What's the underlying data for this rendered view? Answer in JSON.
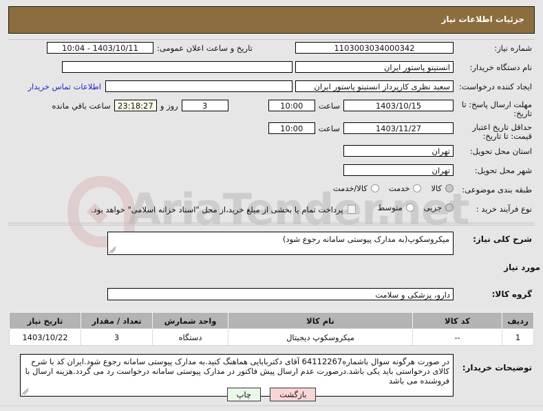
{
  "banner": {
    "title": "جزئیات اطلاعات نیاز"
  },
  "form": {
    "need_number": {
      "label": "شماره نیاز:",
      "value": "1103003034000342"
    },
    "announce_datetime": {
      "label": "تاریخ و ساعت اعلان عمومی:",
      "value": "1403/10/11 - 10:04"
    },
    "buyer_org": {
      "label": "نام دستگاه خریدار:",
      "value": "انستیتو پاستور ایران"
    },
    "buyer_org_secondary": {
      "label": "",
      "value": ""
    },
    "requester": {
      "label": "ایجاد کننده درخواست:",
      "value": "سعید نظری کارپرداز انستیتو پاستور ایران"
    },
    "contact_link": {
      "label": "اطلاعات تماس خریدار",
      "value": ""
    },
    "response_deadline": {
      "label": "مهلت ارسال پاسخ: تا تاریخ:",
      "date": "1403/10/15",
      "time_label": "ساعت",
      "time": "10:00",
      "days": "3",
      "days_label": "روز و",
      "countdown": "23:18:27",
      "countdown_label": "ساعت باقي مانده"
    },
    "price_validity": {
      "label": "حداقل تاریخ اعتبار قیمت: تا تاریخ:",
      "date": "1403/11/27",
      "time_label": "ساعت",
      "time": "10:00"
    },
    "delivery_province": {
      "label": "استان محل تحویل:",
      "value": "تهران"
    },
    "delivery_city": {
      "label": "شهر محل تحویل:",
      "value": "تهران"
    },
    "subject_classification": {
      "label": "طبقه بندی موضوعی:",
      "options": [
        {
          "label": "کالا",
          "selected": true
        },
        {
          "label": "خدمت",
          "selected": false
        },
        {
          "label": "کالا/خدمت",
          "selected": false
        }
      ]
    },
    "purchase_process": {
      "label": "نوع فرآیند خرید :",
      "options": [
        {
          "label": "جزیی",
          "selected": true
        },
        {
          "label": "متوسط",
          "selected": false
        }
      ],
      "checkbox_note": "پرداخت تمام یا بخشی از مبلغ خرید،از محل \"اسناد خزانه اسلامی\" خواهد بود.",
      "checkbox_checked": false
    },
    "general_description": {
      "label": "شرح کلی نیاز:",
      "value": "میکروسکوپ(به مدارک پیوستی سامانه رجوع شود)"
    },
    "goods_section_title": "اطلاعات کالاهاي مورد نیاز",
    "goods_group": {
      "label": "گروه کالا:",
      "value": "دارو، پزشکی و سلامت"
    },
    "buyer_notes": {
      "label": "توضیحات خریدار:",
      "value": "در صورت هرگونه سوال باشماره64112267 آقای دکتربابایی هماهنگ کنید.به مدارک پیوستی سامانه رجوع شود.ایران کد با شرح کالای درخواستی باید یکی باشد.درصورت عدم ارسال پیش فاکتور در مدارک پیوستی سامانه درخواست رد می گردد.هزینه ارسال با فروشنده می باشد"
    }
  },
  "items_table": {
    "headers": [
      "ردیف",
      "کد کالا",
      "نام کالا",
      "واحد شمارش",
      "تعداد / مقدار",
      "تاریخ نیاز"
    ],
    "rows": [
      {
        "row_no": "1",
        "code": "--",
        "name": "میکروسکوپ دیجیتال",
        "unit": "دستگاه",
        "qty": "3",
        "need_date": "1403/10/22"
      }
    ]
  },
  "buttons": {
    "print": "چاپ",
    "back": "بازگشت"
  },
  "watermark": {
    "text": "AriaTender.net"
  },
  "colors": {
    "banner": "#8c6d3f",
    "page_bg": "#e6e6e6",
    "table_header": "#b4b4b4",
    "link": "#2222cc",
    "timer_bg": "#fbfbe8",
    "print_btn": "#e9f7e9",
    "back_btn": "#f9d6d6"
  }
}
